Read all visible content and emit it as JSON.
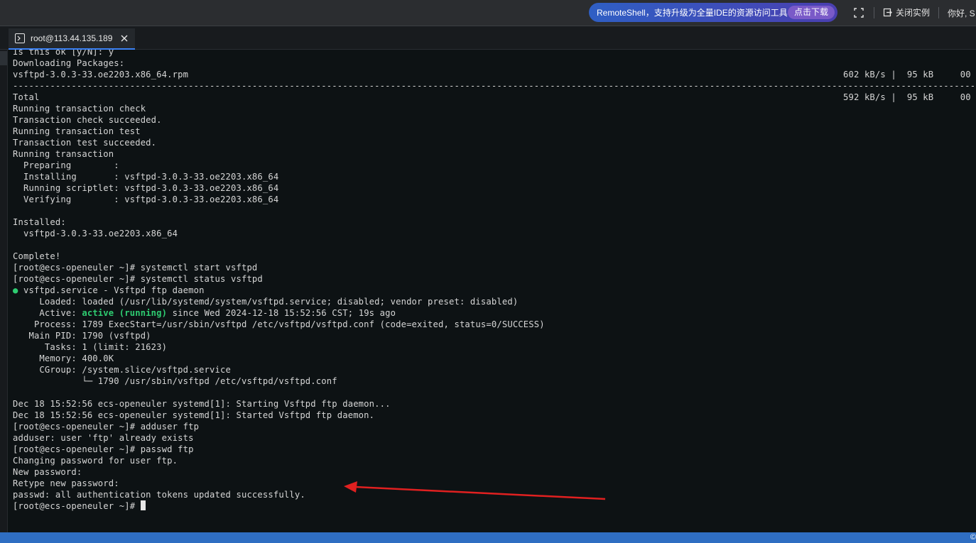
{
  "topbar": {
    "promo_text": "RemoteShell，支持升级为全量IDE的资源访问工具",
    "promo_button": "点击下载",
    "close_instance": "关闭实例",
    "greeting": "你好, S"
  },
  "tab": {
    "label": "root@113.44.135.189"
  },
  "terminal": {
    "lines": [
      {
        "text": "Is this ok [y/N]: y"
      },
      {
        "text": "Downloading Packages:"
      },
      {
        "text": "vsftpd-3.0.3-33.oe2203.x86_64.rpm",
        "right": "602 kB/s |  95 kB     00"
      },
      {
        "text": "--------------------------------------------------------------------------------------------------------------------------------------------------------------------------------------"
      },
      {
        "text": "Total",
        "right": "592 kB/s |  95 kB     00"
      },
      {
        "text": "Running transaction check"
      },
      {
        "text": "Transaction check succeeded."
      },
      {
        "text": "Running transaction test"
      },
      {
        "text": "Transaction test succeeded."
      },
      {
        "text": "Running transaction"
      },
      {
        "text": "  Preparing        :"
      },
      {
        "text": "  Installing       : vsftpd-3.0.3-33.oe2203.x86_64"
      },
      {
        "text": "  Running scriptlet: vsftpd-3.0.3-33.oe2203.x86_64"
      },
      {
        "text": "  Verifying        : vsftpd-3.0.3-33.oe2203.x86_64"
      },
      {
        "text": ""
      },
      {
        "text": "Installed:"
      },
      {
        "text": "  vsftpd-3.0.3-33.oe2203.x86_64"
      },
      {
        "text": ""
      },
      {
        "text": "Complete!"
      },
      {
        "text": "[root@ecs-openeuler ~]# systemctl start vsftpd"
      },
      {
        "text": "[root@ecs-openeuler ~]# systemctl status vsftpd"
      },
      {
        "dot": "●",
        "text": " vsftpd.service - Vsftpd ftp daemon"
      },
      {
        "text": "     Loaded: loaded (/usr/lib/systemd/system/vsftpd.service; disabled; vendor preset: disabled)"
      },
      {
        "text": "     Active: ",
        "green": "active (running)",
        "after": " since Wed 2024-12-18 15:52:56 CST; 19s ago"
      },
      {
        "text": "    Process: 1789 ExecStart=/usr/sbin/vsftpd /etc/vsftpd/vsftpd.conf (code=exited, status=0/SUCCESS)"
      },
      {
        "text": "   Main PID: 1790 (vsftpd)"
      },
      {
        "text": "      Tasks: 1 (limit: 21623)"
      },
      {
        "text": "     Memory: 400.0K"
      },
      {
        "text": "     CGroup: /system.slice/vsftpd.service"
      },
      {
        "text": "             └─ 1790 /usr/sbin/vsftpd /etc/vsftpd/vsftpd.conf"
      },
      {
        "text": ""
      },
      {
        "text": "Dec 18 15:52:56 ecs-openeuler systemd[1]: Starting Vsftpd ftp daemon..."
      },
      {
        "text": "Dec 18 15:52:56 ecs-openeuler systemd[1]: Started Vsftpd ftp daemon."
      },
      {
        "text": "[root@ecs-openeuler ~]# adduser ftp"
      },
      {
        "text": "adduser: user 'ftp' already exists"
      },
      {
        "text": "[root@ecs-openeuler ~]# passwd ftp"
      },
      {
        "text": "Changing password for user ftp."
      },
      {
        "text": "New password:"
      },
      {
        "text": "Retype new password:"
      },
      {
        "text": "passwd: all authentication tokens updated successfully."
      },
      {
        "text": "[root@ecs-openeuler ~]# ",
        "cursor": true
      }
    ]
  },
  "statusbar": {
    "corner_text": "©"
  },
  "colors": {
    "terminal_bg": "#0d1214",
    "terminal_text": "#d6d6d6",
    "active_green": "#2ecc71",
    "annotation_arrow": "#e02020",
    "statusbar": "#2f6ec2",
    "tab_accent": "#3b82f6"
  }
}
